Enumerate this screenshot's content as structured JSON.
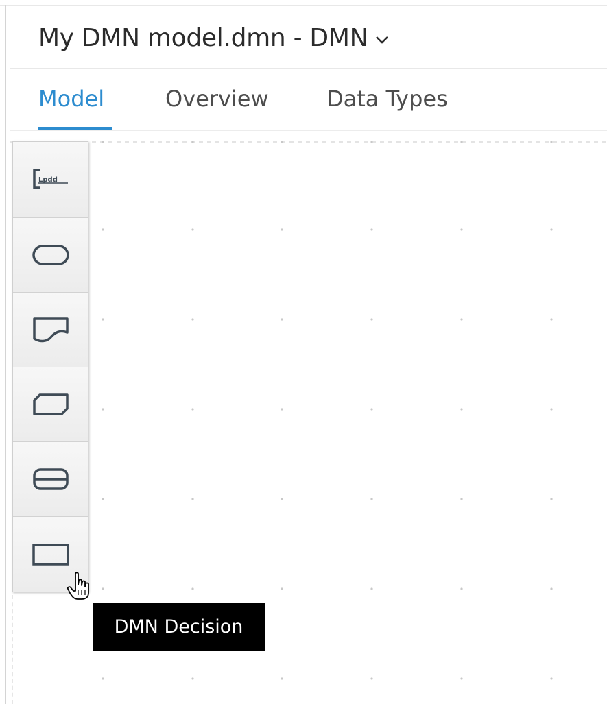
{
  "header": {
    "title": "My DMN model.dmn - DMN",
    "caret_icon": "chevron-down-icon"
  },
  "tabs": [
    {
      "label": "Model",
      "active": true
    },
    {
      "label": "Overview",
      "active": false
    },
    {
      "label": "Data Types",
      "active": false
    }
  ],
  "palette": {
    "items": [
      {
        "icon": "text-annotation-icon"
      },
      {
        "icon": "input-data-icon"
      },
      {
        "icon": "knowledge-source-icon"
      },
      {
        "icon": "business-knowledge-model-icon"
      },
      {
        "icon": "decision-service-icon"
      },
      {
        "icon": "decision-icon"
      }
    ]
  },
  "tooltip": {
    "text": "DMN Decision"
  },
  "colors": {
    "accent": "#2d8ccf",
    "title_text": "#2b2b2b",
    "tab_text": "#4d4d4d",
    "tooltip_bg": "#000000",
    "tooltip_text": "#ffffff",
    "icon_stroke": "#3f4b56",
    "grid_dot": "#c8c8c8"
  }
}
